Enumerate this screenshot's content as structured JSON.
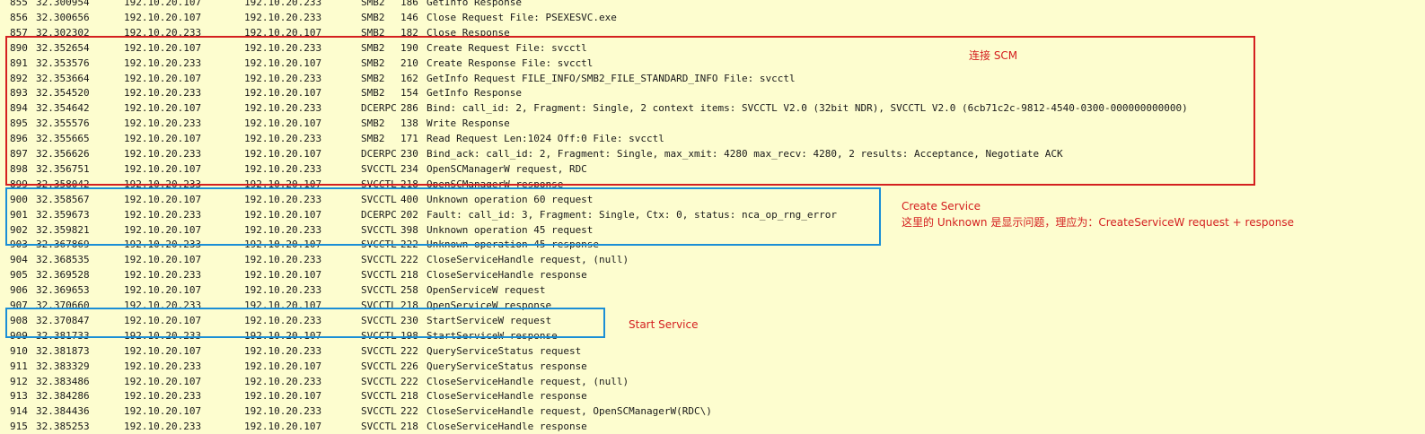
{
  "packets": [
    {
      "no": "855",
      "time": "32.300954",
      "src": "192.10.20.107",
      "dst": "192.10.20.233",
      "proto": "SMB2",
      "len": "186",
      "info": "GetInfo Response"
    },
    {
      "no": "856",
      "time": "32.300656",
      "src": "192.10.20.107",
      "dst": "192.10.20.233",
      "proto": "SMB2",
      "len": "146",
      "info": "Close Request File: PSEXESVC.exe"
    },
    {
      "no": "857",
      "time": "32.302302",
      "src": "192.10.20.233",
      "dst": "192.10.20.107",
      "proto": "SMB2",
      "len": "182",
      "info": "Close Response"
    },
    {
      "no": "890",
      "time": "32.352654",
      "src": "192.10.20.107",
      "dst": "192.10.20.233",
      "proto": "SMB2",
      "len": "190",
      "info": "Create Request File: svcctl"
    },
    {
      "no": "891",
      "time": "32.353576",
      "src": "192.10.20.233",
      "dst": "192.10.20.107",
      "proto": "SMB2",
      "len": "210",
      "info": "Create Response File: svcctl"
    },
    {
      "no": "892",
      "time": "32.353664",
      "src": "192.10.20.107",
      "dst": "192.10.20.233",
      "proto": "SMB2",
      "len": "162",
      "info": "GetInfo Request FILE_INFO/SMB2_FILE_STANDARD_INFO File: svcctl"
    },
    {
      "no": "893",
      "time": "32.354520",
      "src": "192.10.20.233",
      "dst": "192.10.20.107",
      "proto": "SMB2",
      "len": "154",
      "info": "GetInfo Response"
    },
    {
      "no": "894",
      "time": "32.354642",
      "src": "192.10.20.107",
      "dst": "192.10.20.233",
      "proto": "DCERPC",
      "len": "286",
      "info": "Bind: call_id: 2, Fragment: Single, 2 context items: SVCCTL V2.0 (32bit NDR), SVCCTL V2.0 (6cb71c2c-9812-4540-0300-000000000000)"
    },
    {
      "no": "895",
      "time": "32.355576",
      "src": "192.10.20.233",
      "dst": "192.10.20.107",
      "proto": "SMB2",
      "len": "138",
      "info": "Write Response"
    },
    {
      "no": "896",
      "time": "32.355665",
      "src": "192.10.20.107",
      "dst": "192.10.20.233",
      "proto": "SMB2",
      "len": "171",
      "info": "Read Request Len:1024 Off:0 File: svcctl"
    },
    {
      "no": "897",
      "time": "32.356626",
      "src": "192.10.20.233",
      "dst": "192.10.20.107",
      "proto": "DCERPC",
      "len": "230",
      "info": "Bind_ack: call_id: 2, Fragment: Single, max_xmit: 4280 max_recv: 4280, 2 results: Acceptance, Negotiate ACK"
    },
    {
      "no": "898",
      "time": "32.356751",
      "src": "192.10.20.107",
      "dst": "192.10.20.233",
      "proto": "SVCCTL",
      "len": "234",
      "info": "OpenSCManagerW request, RDC"
    },
    {
      "no": "899",
      "time": "32.358042",
      "src": "192.10.20.233",
      "dst": "192.10.20.107",
      "proto": "SVCCTL",
      "len": "218",
      "info": "OpenSCManagerW response"
    },
    {
      "no": "900",
      "time": "32.358567",
      "src": "192.10.20.107",
      "dst": "192.10.20.233",
      "proto": "SVCCTL",
      "len": "400",
      "info": "Unknown operation 60 request"
    },
    {
      "no": "901",
      "time": "32.359673",
      "src": "192.10.20.233",
      "dst": "192.10.20.107",
      "proto": "DCERPC",
      "len": "202",
      "info": "Fault: call_id: 3, Fragment: Single, Ctx: 0, status: nca_op_rng_error"
    },
    {
      "no": "902",
      "time": "32.359821",
      "src": "192.10.20.107",
      "dst": "192.10.20.233",
      "proto": "SVCCTL",
      "len": "398",
      "info": "Unknown operation 45 request"
    },
    {
      "no": "903",
      "time": "32.367869",
      "src": "192.10.20.233",
      "dst": "192.10.20.107",
      "proto": "SVCCTL",
      "len": "222",
      "info": "Unknown operation 45 response"
    },
    {
      "no": "904",
      "time": "32.368535",
      "src": "192.10.20.107",
      "dst": "192.10.20.233",
      "proto": "SVCCTL",
      "len": "222",
      "info": "CloseServiceHandle request, (null)"
    },
    {
      "no": "905",
      "time": "32.369528",
      "src": "192.10.20.233",
      "dst": "192.10.20.107",
      "proto": "SVCCTL",
      "len": "218",
      "info": "CloseServiceHandle response"
    },
    {
      "no": "906",
      "time": "32.369653",
      "src": "192.10.20.107",
      "dst": "192.10.20.233",
      "proto": "SVCCTL",
      "len": "258",
      "info": "OpenServiceW request"
    },
    {
      "no": "907",
      "time": "32.370660",
      "src": "192.10.20.233",
      "dst": "192.10.20.107",
      "proto": "SVCCTL",
      "len": "218",
      "info": "OpenServiceW response"
    },
    {
      "no": "908",
      "time": "32.370847",
      "src": "192.10.20.107",
      "dst": "192.10.20.233",
      "proto": "SVCCTL",
      "len": "230",
      "info": "StartServiceW request"
    },
    {
      "no": "909",
      "time": "32.381733",
      "src": "192.10.20.233",
      "dst": "192.10.20.107",
      "proto": "SVCCTL",
      "len": "198",
      "info": "StartServiceW response"
    },
    {
      "no": "910",
      "time": "32.381873",
      "src": "192.10.20.107",
      "dst": "192.10.20.233",
      "proto": "SVCCTL",
      "len": "222",
      "info": "QueryServiceStatus request"
    },
    {
      "no": "911",
      "time": "32.383329",
      "src": "192.10.20.233",
      "dst": "192.10.20.107",
      "proto": "SVCCTL",
      "len": "226",
      "info": "QueryServiceStatus response"
    },
    {
      "no": "912",
      "time": "32.383486",
      "src": "192.10.20.107",
      "dst": "192.10.20.233",
      "proto": "SVCCTL",
      "len": "222",
      "info": "CloseServiceHandle request, (null)"
    },
    {
      "no": "913",
      "time": "32.384286",
      "src": "192.10.20.233",
      "dst": "192.10.20.107",
      "proto": "SVCCTL",
      "len": "218",
      "info": "CloseServiceHandle response"
    },
    {
      "no": "914",
      "time": "32.384436",
      "src": "192.10.20.107",
      "dst": "192.10.20.233",
      "proto": "SVCCTL",
      "len": "222",
      "info": "CloseServiceHandle request, OpenSCManagerW(RDC\\)"
    },
    {
      "no": "915",
      "time": "32.385253",
      "src": "192.10.20.233",
      "dst": "192.10.20.107",
      "proto": "SVCCTL",
      "len": "218",
      "info": "CloseServiceHandle response"
    }
  ],
  "annotations": {
    "scm": {
      "text": "连接 SCM",
      "color": "#d42020"
    },
    "create_service": {
      "line1": "Create Service",
      "line2": "这里的 Unknown 是显示问题，理应为：CreateServiceW request + response",
      "color": "#d42020"
    },
    "start_service": {
      "text": "Start Service",
      "color": "#d42020"
    }
  },
  "colors": {
    "background": "#fdfdcf",
    "text": "#1a1a1a",
    "red_box": "#d42020",
    "blue_box": "#1b8fd6"
  }
}
